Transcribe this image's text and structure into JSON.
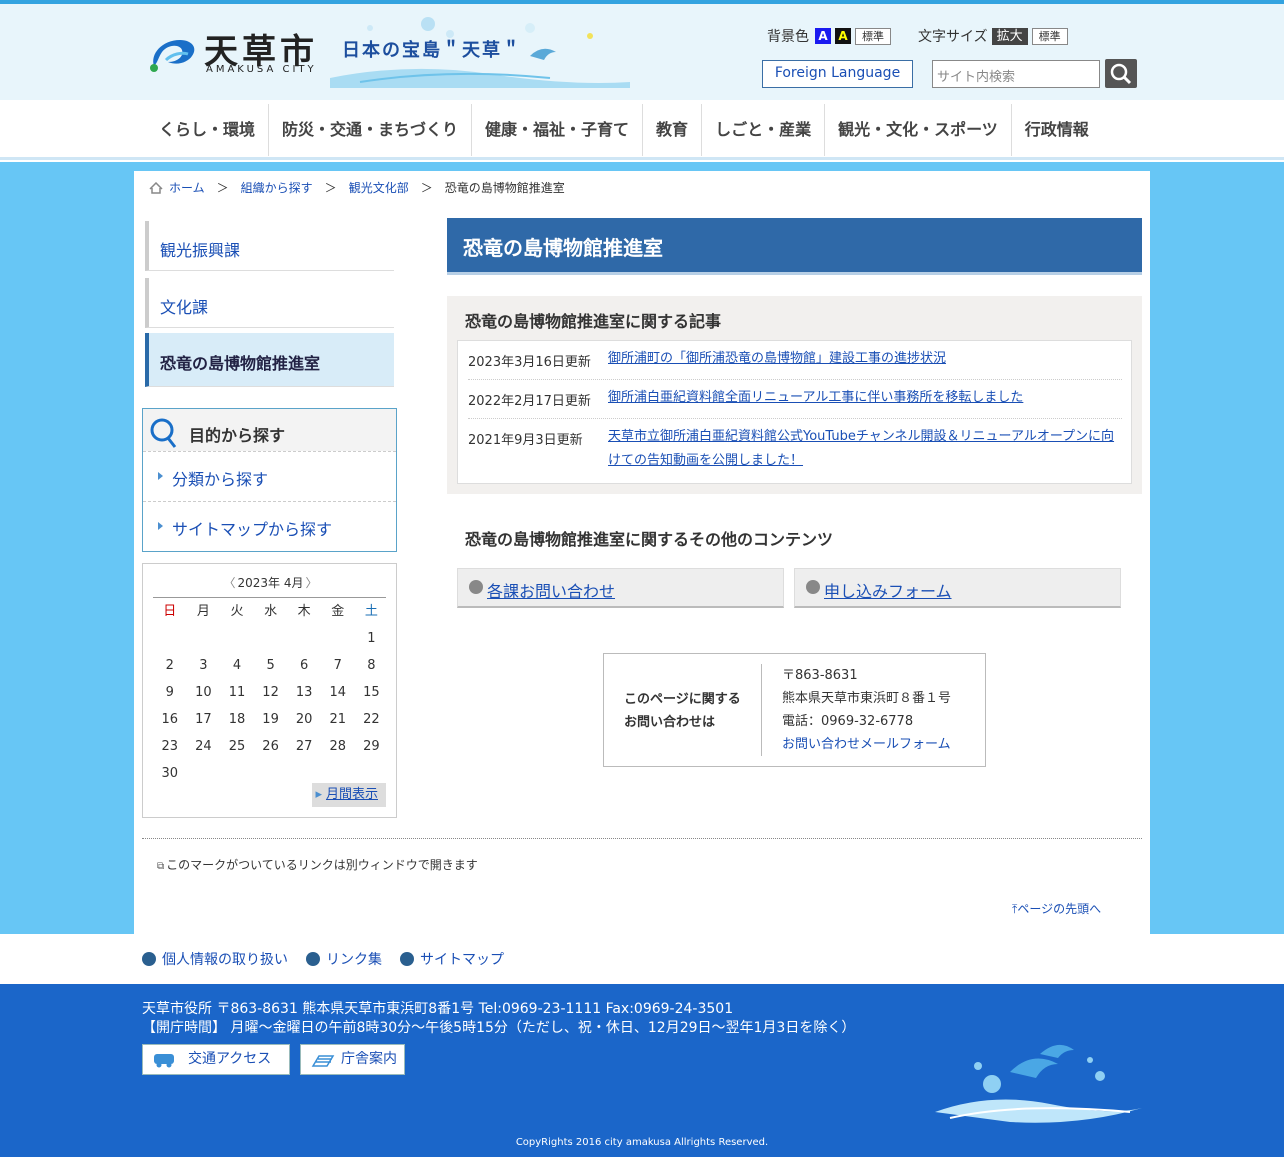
{
  "header": {
    "logo_text": "天草市",
    "logo_sub": "AMAKUSA CITY",
    "tagline": "日本の宝島＂天草＂",
    "bgcolor_label": "背景色",
    "bg_a1": "A",
    "bg_a2": "A",
    "bg_std": "標準",
    "fontsize_label": "文字サイズ",
    "fs_big": "拡大",
    "fs_std": "標準",
    "foreign_language": "Foreign Language",
    "search_placeholder": "サイト内検索"
  },
  "gnav": [
    "くらし・環境",
    "防災・交通・まちづくり",
    "健康・福祉・子育て",
    "教育",
    "しごと・産業",
    "観光・文化・スポーツ",
    "行政情報"
  ],
  "breadcrumb": {
    "home": "ホーム",
    "sep": "＞",
    "b1": "組織から探す",
    "b2": "観光文化部",
    "current": "恐竜の島博物館推進室"
  },
  "sidebar": {
    "items": [
      {
        "label": "観光振興課"
      },
      {
        "label": "文化課"
      },
      {
        "label": "恐竜の島博物館推進室"
      }
    ],
    "purpose_title": "目的から探す",
    "purpose_links": [
      "分類から探す",
      "サイトマップから探す"
    ]
  },
  "calendar": {
    "title": "2023年 4月",
    "weekdays": [
      "日",
      "月",
      "火",
      "水",
      "木",
      "金",
      "土"
    ],
    "first_weekday": 6,
    "days": 30,
    "month_view": "月間表示",
    "colors": {
      "sunday": "#cc0000",
      "saturday": "#1a6fb5"
    }
  },
  "main": {
    "title": "恐竜の島博物館推進室",
    "articles_heading": "恐竜の島博物館推進室に関する記事",
    "articles": [
      {
        "date": "2023年3月16日更新",
        "title": "御所浦町の「御所浦恐竜の島博物館」建設工事の進捗状況"
      },
      {
        "date": "2022年2月17日更新",
        "title": "御所浦白亜紀資料館全面リニューアル工事に伴い事務所を移転しました"
      },
      {
        "date": "2021年9月3日更新",
        "title": "天草市立御所浦白亜紀資料館公式YouTubeチャンネル開設＆リニューアルオープンに向けての告知動画を公開しました！"
      }
    ],
    "other_heading": "恐竜の島博物館推進室に関するその他のコンテンツ",
    "other_links": [
      "各課お問い合わせ",
      "申し込みフォーム"
    ],
    "contact": {
      "label1": "このページに関する",
      "label2": "お問い合わせは",
      "zip": "〒863-8631",
      "address": "熊本県天草市東浜町８番１号",
      "tel": "電話：0969-32-6778",
      "mail": "お問い合わせメールフォーム"
    },
    "note": "このマークがついているリンクは別ウィンドウで開きます",
    "pagetop": "ページの先頭へ"
  },
  "footer": {
    "links": [
      "個人情報の取り扱い",
      "リンク集",
      "サイトマップ"
    ],
    "address": "天草市役所 〒863-8631  熊本県天草市東浜町8番1号   Tel:0969-23-1111   Fax:0969-24-3501",
    "hours": "【開庁時間】 月曜～金曜日の午前8時30分～午後5時15分（ただし、祝・休日、12月29日～翌年1月3日を除く）",
    "access": "交通アクセス",
    "office": "庁舎案内",
    "copyright": "CopyRights 2016 city amakusa Allrights Reserved."
  }
}
